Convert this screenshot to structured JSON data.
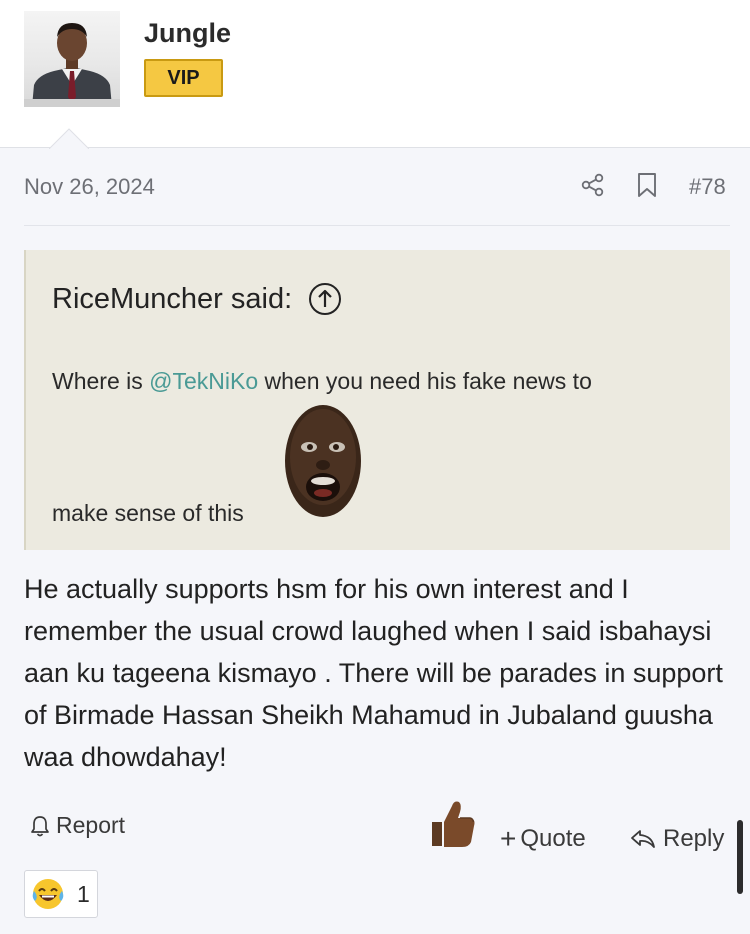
{
  "user": {
    "name": "Jungle",
    "badge": "VIP"
  },
  "post": {
    "date": "Nov 26, 2024",
    "number": "#78",
    "body": "He actually supports hsm for his own interest and I remember the usual crowd laughed when I said isbahaysi aan ku tageena kismayo . There will be parades in support of Birmade Hassan Sheikh Mahamud in Jubaland guusha waa dhowdahay!"
  },
  "quote": {
    "author": "RiceMuncher said:",
    "line1_prefix": "Where is ",
    "mention": "@TekNiKo",
    "line1_suffix": " when you need his fake news to",
    "line2": "make sense of this"
  },
  "actions": {
    "report": "Report",
    "quote": "Quote",
    "reply": "Reply"
  },
  "reactions": [
    {
      "icon": "laughing-tears-emoji-icon",
      "count": "1"
    }
  ],
  "icons": {
    "share": "share-icon",
    "bookmark": "bookmark-icon",
    "quote_up": "arrow-up-circle-icon",
    "report": "bell-icon",
    "reply": "reply-arrow-icon",
    "like": "thumbs-up-icon"
  },
  "colors": {
    "vip_badge": "#f5c842",
    "mention": "#4a9a95",
    "quote_bg": "#eceae0",
    "page_bg": "#f5f6fa"
  }
}
